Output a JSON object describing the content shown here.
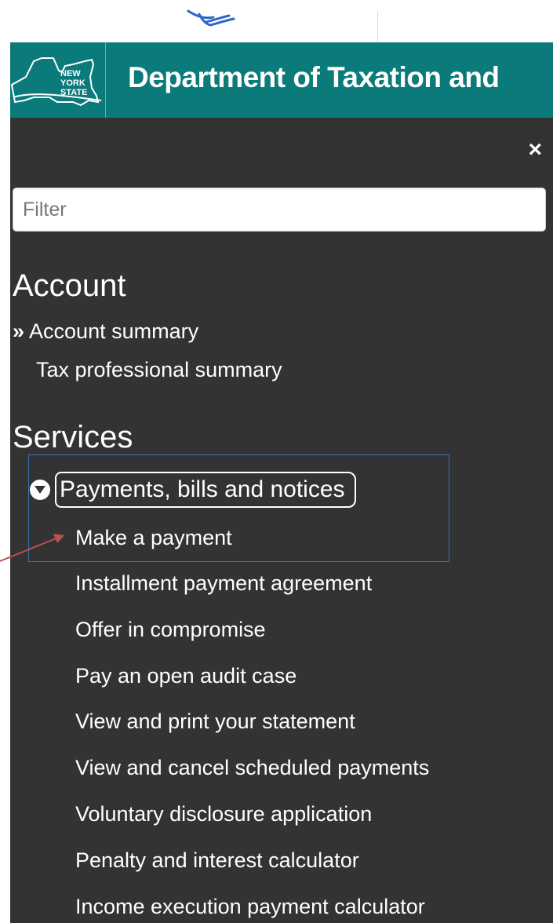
{
  "header": {
    "logo_text": [
      "NEW",
      "YORK",
      "STATE"
    ],
    "title": "Department of Taxation and"
  },
  "menu": {
    "close_label": "×",
    "filter_placeholder": "Filter",
    "sections": [
      {
        "title": "Account",
        "items": [
          {
            "label": "Account summary",
            "current": true
          },
          {
            "label": "Tax professional summary",
            "current": false
          }
        ]
      },
      {
        "title": "Services",
        "group": {
          "label": "Payments, bills and notices",
          "expanded": true,
          "items": [
            "Make a payment",
            "Installment payment agreement",
            "Offer in compromise",
            "Pay an open audit case",
            "View and print your statement",
            "View and cancel scheduled payments",
            "Voluntary disclosure application",
            "Penalty and interest calculator",
            "Income execution payment calculator"
          ]
        }
      }
    ],
    "current_marker": "»"
  },
  "colors": {
    "header_bg": "#0b7a7a",
    "panel_bg": "#333333",
    "text": "#ffffff",
    "highlight_border": "#3a71b8",
    "arrow": "#c0504d"
  }
}
